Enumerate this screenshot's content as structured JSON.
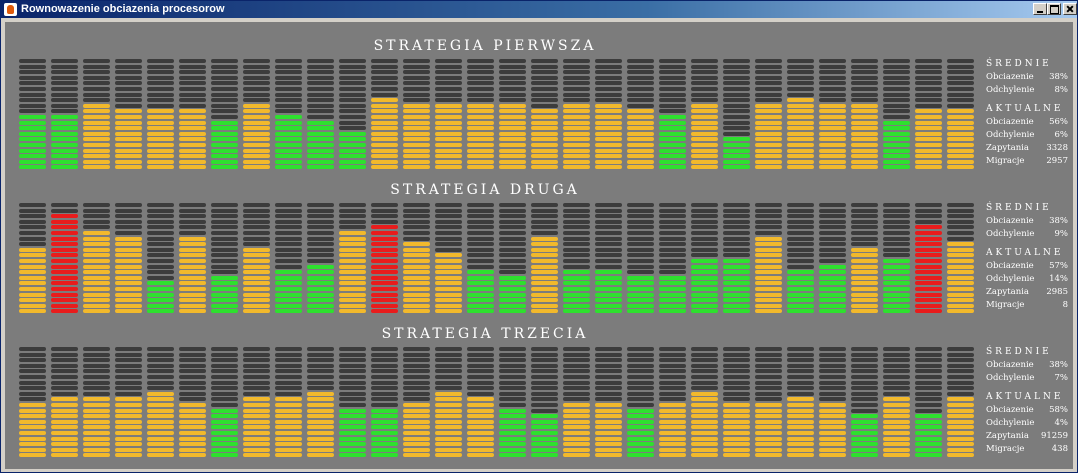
{
  "window": {
    "title": "Rownowazenie obciazenia procesorow",
    "icon": "java-icon"
  },
  "colors": {
    "empty": "#3c3c3c",
    "low": "#2ee02e",
    "mid": "#f2b92c",
    "high": "#e81c1c",
    "background": "#7c7c7c"
  },
  "level_max": 20,
  "strategies": [
    {
      "title": "STRATEGIA PIERWSZA",
      "levels": [
        10,
        10,
        12,
        11,
        11,
        11,
        9,
        12,
        10,
        9,
        7,
        13,
        12,
        12,
        12,
        12,
        11,
        12,
        12,
        11,
        10,
        12,
        6,
        12,
        13,
        12,
        12,
        9,
        11,
        11
      ],
      "colors": [
        "low",
        "low",
        "mid",
        "mid",
        "mid",
        "mid",
        "low",
        "mid",
        "low",
        "low",
        "low",
        "mid",
        "mid",
        "mid",
        "mid",
        "mid",
        "mid",
        "mid",
        "mid",
        "mid",
        "low",
        "mid",
        "low",
        "mid",
        "mid",
        "mid",
        "mid",
        "low",
        "mid",
        "mid"
      ],
      "srednie": {
        "label": "ŚREDNIE",
        "rows": [
          {
            "label": "Obciazenie",
            "value": "38%"
          },
          {
            "label": "Odchylenie",
            "value": "8%"
          }
        ]
      },
      "aktualne": {
        "label": "AKTUALNE",
        "rows": [
          {
            "label": "Obciazenie",
            "value": "56%"
          },
          {
            "label": "Odchylenie",
            "value": "6%"
          },
          {
            "label": "Zapytania",
            "value": "3328"
          },
          {
            "label": "Migracje",
            "value": "2957"
          }
        ]
      }
    },
    {
      "title": "STRATEGIA DRUGA",
      "levels": [
        12,
        18,
        15,
        14,
        6,
        14,
        7,
        12,
        8,
        9,
        15,
        16,
        13,
        11,
        8,
        7,
        14,
        8,
        8,
        7,
        7,
        10,
        10,
        14,
        8,
        9,
        12,
        10,
        16,
        13
      ],
      "colors": [
        "mid",
        "high",
        "mid",
        "mid",
        "low",
        "mid",
        "low",
        "mid",
        "low",
        "low",
        "mid",
        "high",
        "mid",
        "mid",
        "low",
        "low",
        "mid",
        "low",
        "low",
        "low",
        "low",
        "low",
        "low",
        "mid",
        "low",
        "low",
        "mid",
        "low",
        "high",
        "mid"
      ],
      "srednie": {
        "label": "ŚREDNIE",
        "rows": [
          {
            "label": "Obciazenie",
            "value": "38%"
          },
          {
            "label": "Odchylenie",
            "value": "9%"
          }
        ]
      },
      "aktualne": {
        "label": "AKTUALNE",
        "rows": [
          {
            "label": "Obciazenie",
            "value": "57%"
          },
          {
            "label": "Odchylenie",
            "value": "14%"
          },
          {
            "label": "Zapytania",
            "value": "2985"
          },
          {
            "label": "Migracje",
            "value": "8"
          }
        ]
      }
    },
    {
      "title": "STRATEGIA TRZECIA",
      "levels": [
        10,
        11,
        11,
        11,
        12,
        10,
        9,
        11,
        11,
        12,
        9,
        9,
        10,
        12,
        11,
        9,
        8,
        10,
        10,
        9,
        10,
        12,
        10,
        10,
        11,
        10,
        8,
        11,
        8,
        11
      ],
      "colors": [
        "mid",
        "mid",
        "mid",
        "mid",
        "mid",
        "mid",
        "low",
        "mid",
        "mid",
        "mid",
        "low",
        "low",
        "mid",
        "mid",
        "mid",
        "low",
        "low",
        "mid",
        "mid",
        "low",
        "mid",
        "mid",
        "mid",
        "mid",
        "mid",
        "mid",
        "low",
        "mid",
        "low",
        "mid"
      ],
      "srednie": {
        "label": "ŚREDNIE",
        "rows": [
          {
            "label": "Obciazenie",
            "value": "38%"
          },
          {
            "label": "Odchylenie",
            "value": "7%"
          }
        ]
      },
      "aktualne": {
        "label": "AKTUALNE",
        "rows": [
          {
            "label": "Obciazenie",
            "value": "58%"
          },
          {
            "label": "Odchylenie",
            "value": "4%"
          },
          {
            "label": "Zapytania",
            "value": "91259"
          },
          {
            "label": "Migracje",
            "value": "438"
          }
        ]
      }
    }
  ]
}
